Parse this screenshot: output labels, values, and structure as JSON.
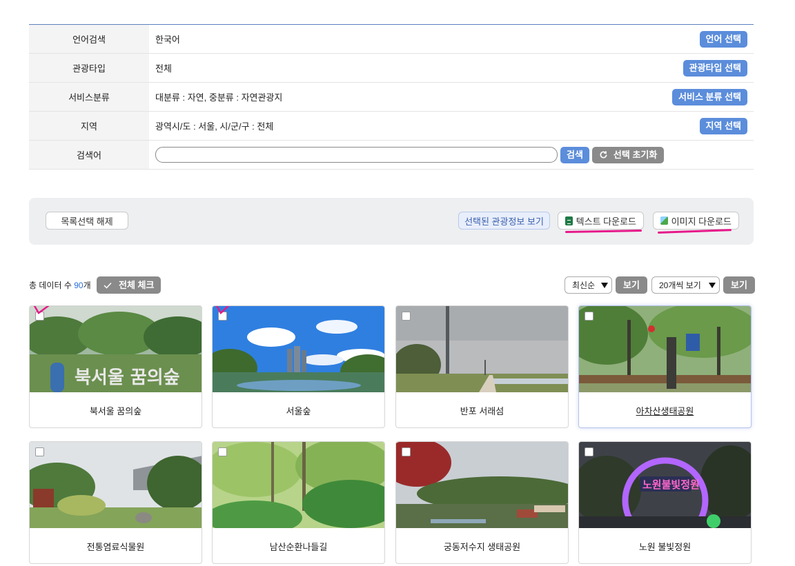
{
  "filters": [
    {
      "label": "언어검색",
      "value": "한국어",
      "button": "언어 선택"
    },
    {
      "label": "관광타입",
      "value": "전체",
      "button": "관광타입 선택"
    },
    {
      "label": "서비스분류",
      "value": "대분류 : 자연,  중분류 : 자연관광지",
      "button": "서비스 분류 선택"
    },
    {
      "label": "지역",
      "value": "광역시/도 : 서울,  시/군/구 : 전체",
      "button": "지역 선택"
    }
  ],
  "search": {
    "label": "검색어",
    "value": "",
    "placeholder": "",
    "search_button": "검색",
    "reset_button": "선택 초기화"
  },
  "actions": {
    "deselect": "목록선택 해제",
    "view_selected": "선택된 관광정보 보기",
    "text_download": "텍스트 다운로드",
    "image_download": "이미지 다운로드"
  },
  "list": {
    "total_prefix": "총 데이터 수 ",
    "total_count": "90",
    "total_suffix": "개",
    "check_all": "전체 체크",
    "sort_value": "최신순",
    "sort_view_button": "보기",
    "page_size_value": "20개씩 보기",
    "page_size_view_button": "보기"
  },
  "cards": [
    {
      "title": "북서울 꿈의숲",
      "checked_mark": true
    },
    {
      "title": "서울숲",
      "checked_mark": true
    },
    {
      "title": "반포 서래섬",
      "checked_mark": false
    },
    {
      "title": "아차산생태공원",
      "checked_mark": false,
      "hovered": true
    },
    {
      "title": "전통염료식물원",
      "checked_mark": false
    },
    {
      "title": "남산순환나들길",
      "checked_mark": false
    },
    {
      "title": "궁동저수지 생태공원",
      "checked_mark": false
    },
    {
      "title": "노원 불빛정원",
      "checked_mark": false
    }
  ],
  "icons": {
    "text_download": "spreadsheet-icon",
    "image_download": "image-icon",
    "reset": "refresh-icon",
    "check_all": "checkmark-icon"
  },
  "colors": {
    "primary_button": "#5b8ddb",
    "secondary_button": "#8a8a8a",
    "annotation": "#e6198a",
    "count": "#2a6fdb"
  }
}
